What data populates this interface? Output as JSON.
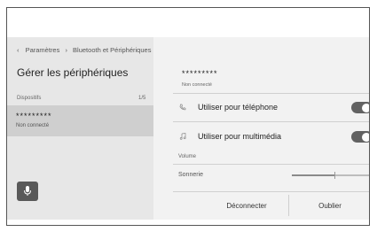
{
  "breadcrumb": {
    "back_icon": "chevron-left-icon",
    "items": [
      "Paramètres",
      "Bluetooth et Périphériques"
    ],
    "separator": "›"
  },
  "sidebar": {
    "title": "Gérer les périphériques",
    "section_label": "Dispositifs",
    "section_count": "1/5",
    "devices": [
      {
        "name": "*********",
        "status": "Non connecté"
      }
    ],
    "mic_icon": "microphone-icon"
  },
  "detail": {
    "device_name": "*********",
    "device_status": "Non connecté",
    "options": [
      {
        "icon": "phone-icon",
        "label": "Utiliser pour téléphone",
        "enabled": true
      },
      {
        "icon": "music-note-icon",
        "label": "Utiliser pour multimédia",
        "enabled": true
      }
    ],
    "volume_label": "Volume",
    "ringtone_label": "Sonnerie",
    "ringtone_level": 0.53,
    "disconnect_label": "Déconnecter",
    "forget_label": "Oublier"
  },
  "colors": {
    "toggle_on": "#626262",
    "selected_row": "#cfcfcf",
    "mic_button": "#595959"
  }
}
